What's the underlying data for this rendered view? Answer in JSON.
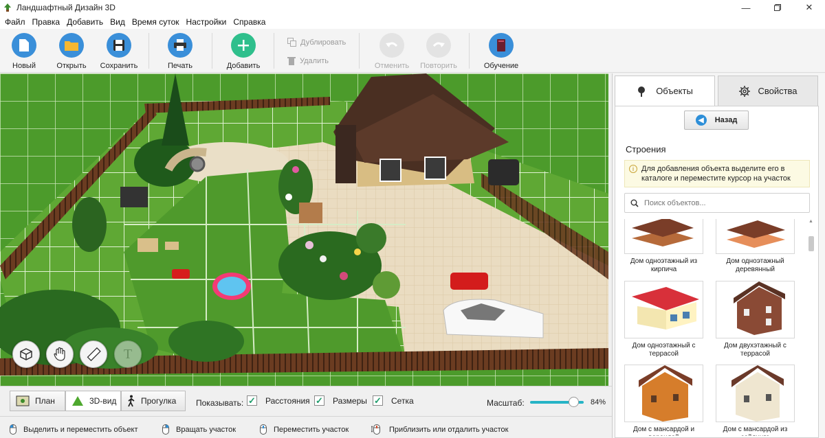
{
  "window": {
    "title": "Ландшафтный Дизайн 3D",
    "minimize_icon": "minimize-icon",
    "maximize_icon": "maximize-icon",
    "close_icon": "close-icon"
  },
  "menu": [
    "Файл",
    "Правка",
    "Добавить",
    "Вид",
    "Время суток",
    "Настройки",
    "Справка"
  ],
  "toolbar": {
    "new": "Новый",
    "open": "Открыть",
    "save": "Сохранить",
    "print": "Печать",
    "add": "Добавить",
    "duplicate": "Дублировать",
    "delete": "Удалить",
    "undo": "Отменить",
    "redo": "Повторить",
    "learn": "Обучение"
  },
  "viewport": {
    "tools": [
      "objects-tool-icon",
      "hand-pan-icon",
      "ruler-icon",
      "text-icon"
    ]
  },
  "view_modes": {
    "plan": "План",
    "view3d": "3D-вид",
    "walk": "Прогулка",
    "active": "3D-вид"
  },
  "display": {
    "label": "Показывать:",
    "distances": {
      "label": "Расстояния",
      "checked": true
    },
    "sizes": {
      "label": "Размеры",
      "checked": true
    },
    "grid": {
      "label": "Сетка",
      "checked": true
    }
  },
  "scale": {
    "label": "Масштаб:",
    "value": "84%",
    "level": 0.84
  },
  "status": {
    "select": "Выделить и переместить объект",
    "rotate": "Вращать участок",
    "move": "Переместить участок",
    "zoom": "Приблизить или отдалить участок"
  },
  "panel": {
    "tab_objects": "Объекты",
    "tab_properties": "Свойства",
    "back": "Назад",
    "section_title": "Строения",
    "hint": "Для добавления объекта выделите его в каталоге и переместите курсор на участок",
    "search_placeholder": "Поиск объектов...",
    "items": [
      {
        "label": "Дом одноэтажный из кирпича"
      },
      {
        "label": "Дом одноэтажный деревянный"
      },
      {
        "label": "Дом одноэтажный с террасой"
      },
      {
        "label": "Дом двухэтажный с террасой"
      },
      {
        "label": "Дом с мансардой и верандой"
      },
      {
        "label": "Дом с мансардой из сайдинга"
      }
    ]
  }
}
